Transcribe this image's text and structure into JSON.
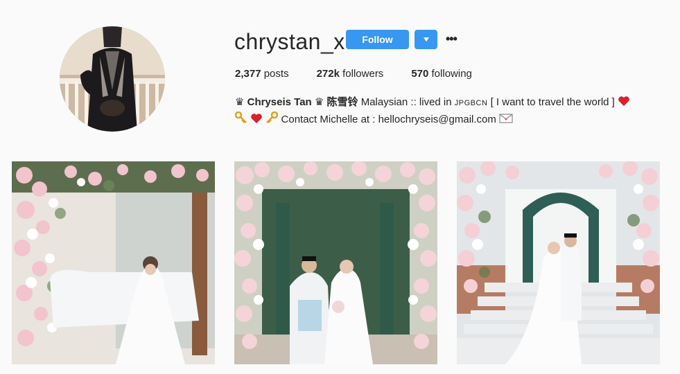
{
  "profile": {
    "username": "chrystan_x",
    "follow_label": "Follow",
    "dropdown_icon": "caret-down-icon",
    "more_icon": "ellipsis-icon",
    "more_glyph": "•••",
    "avatar_icon": "profile-photo"
  },
  "stats": {
    "posts_count": "2,377",
    "posts_label": "posts",
    "followers_count": "272k",
    "followers_label": "followers",
    "following_count": "570",
    "following_label": "following"
  },
  "bio": {
    "crown_1": "♛",
    "name": "Chryseis Tan",
    "crown_2": "♛",
    "chinese_name": "陈雪铃",
    "line_1_text": "Malaysian :: lived in",
    "location": "JPGBCN",
    "line_1_tail": "[ I want to travel the world ]",
    "contact_text": "Contact Michelle at : hellochryseis@gmail.com"
  },
  "posts": [
    {
      "icon": "wedding-photo-1"
    },
    {
      "icon": "wedding-photo-2"
    },
    {
      "icon": "wedding-photo-3"
    }
  ],
  "colors": {
    "accent": "#3897f0",
    "background": "#fafafa",
    "text": "#262626"
  }
}
